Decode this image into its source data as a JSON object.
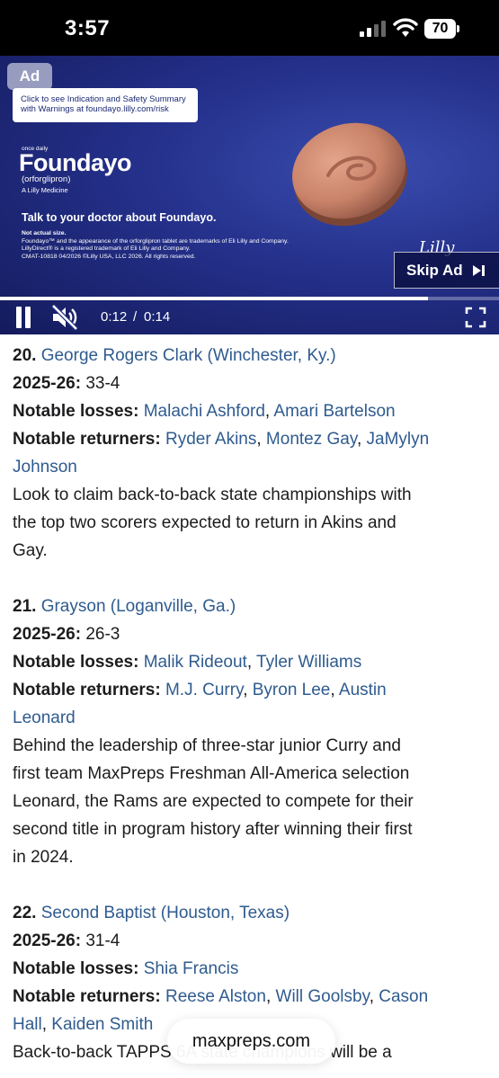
{
  "status_bar": {
    "time": "3:57",
    "battery": "70"
  },
  "ad": {
    "badge": "Ad",
    "safety_line1": "Click to see Indication and Safety Summary",
    "safety_line2": "with Warnings at foundayo.lilly.com/risk",
    "once_daily": "once daily",
    "brand": "Foundayo",
    "generic": "(orforglipron)",
    "company": "A Lilly Medicine",
    "headline": "Talk to your doctor about Foundayo.",
    "fine_1": "Not actual size.",
    "fine_2": "Foundayo™ and the appearance of the orforglipron tablet are trademarks of Eli Lilly and Company.",
    "fine_3": "LillyDirect® is a registered trademark of Eli Lilly and Company.",
    "fine_4": "CMAT-10818 04/2026 ©Lilly USA, LLC 2026. All rights reserved.",
    "lilly": "Lilly",
    "skip_label": "Skip Ad",
    "current_time": "0:12",
    "separator": "/",
    "duration": "0:14",
    "progress_fraction": 0.857
  },
  "entries": [
    {
      "rank": "20.",
      "school": "George Rogers Clark (Winchester, Ky.)",
      "record_label": "2025-26:",
      "record": "33-4",
      "losses_label": "Notable losses:",
      "loss_1": "Malachi Ashford",
      "loss_2": "Amari Bartelson",
      "returners_label": "Notable returners:",
      "ret_1": "Ryder Akins",
      "ret_2": "Montez Gay",
      "ret_3a": "JaMylyn",
      "ret_3b": "Johnson",
      "desc_1": "Look to claim back-to-back state championships with",
      "desc_2": "the top two scorers expected to return in Akins and",
      "desc_3": "Gay."
    },
    {
      "rank": "21.",
      "school": "Grayson (Loganville, Ga.)",
      "record_label": "2025-26:",
      "record": "26-3",
      "losses_label": "Notable losses:",
      "loss_1": "Malik Rideout",
      "loss_2": "Tyler Williams",
      "returners_label": "Notable returners:",
      "ret_1": "M.J. Curry",
      "ret_2": "Byron Lee",
      "ret_3a": "Austin",
      "ret_3b": "Leonard",
      "desc_1": "Behind the leadership of three-star junior Curry and",
      "desc_2": "first team MaxPreps Freshman All-America selection",
      "desc_3": "Leonard, the Rams are expected to compete for their",
      "desc_4": "second title in program history after winning their first",
      "desc_5": "in 2024."
    },
    {
      "rank": "22.",
      "school": "Second Baptist (Houston, Texas)",
      "record_label": "2025-26:",
      "record": "31-4",
      "losses_label": "Notable losses:",
      "loss_1": "Shia Francis",
      "returners_label": "Notable returners:",
      "ret_1": "Reese Alston",
      "ret_2": "Will Goolsby",
      "ret_3a": "Cason",
      "ret_3b": "Hall",
      "ret_4": "Kaiden Smith",
      "desc_1": "Back-to-back TAPPS 6A state champions will be a"
    }
  ],
  "url_bar": {
    "domain": "maxpreps.com"
  }
}
